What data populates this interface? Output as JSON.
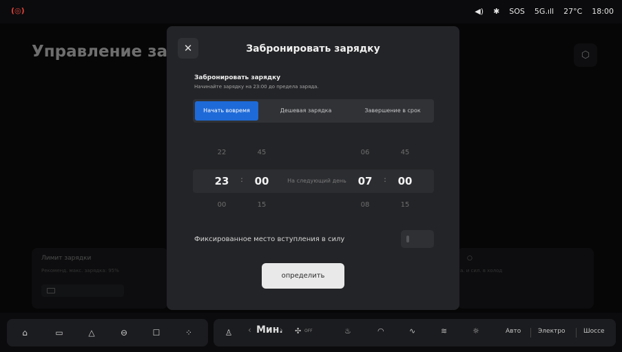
{
  "status_bar": {
    "alert_icon": "warning-icon",
    "volume_icon": "volume-icon",
    "bluetooth_icon": "bluetooth-icon",
    "sos": "SOS",
    "network": "5G",
    "signal_icon": "signal-icon",
    "temperature": "27°C",
    "time": "18:00"
  },
  "background": {
    "page_title": "Управление заря",
    "settings_icon": "settings-icon",
    "charge_limit_card": {
      "title": "Лимит зарядки",
      "subtitle": "Рекоменд. макс. зарядка: 95%"
    },
    "right_card": {
      "subtitle": "а. и сил. в холод"
    }
  },
  "modal": {
    "title": "Забронировать зарядку",
    "close_icon": "close-icon",
    "section_title": "Забронировать зарядку",
    "section_subtitle": "Начинайте зарядку на 23:00 до предела заряда.",
    "tabs": [
      {
        "label": "Начать вовремя",
        "active": true
      },
      {
        "label": "Дешевая зарядка",
        "active": false
      },
      {
        "label": "Завершение в срок",
        "active": false
      }
    ],
    "picker": {
      "start_hour": {
        "prev": "22",
        "current": "23",
        "next": "00"
      },
      "start_minute": {
        "prev": "45",
        "current": "00",
        "next": "15"
      },
      "separator": ":",
      "next_day_label": "На следующий день",
      "end_hour": {
        "prev": "06",
        "current": "07",
        "next": "08"
      },
      "end_minute": {
        "prev": "45",
        "current": "00",
        "next": "15"
      }
    },
    "fixed_location_label": "Фиксированное место вступления в силу",
    "fixed_location_enabled": false,
    "confirm_label": "определить"
  },
  "dock": {
    "left_icons": [
      "home-icon",
      "screen-icon",
      "navigation-icon",
      "car-icon",
      "seat-icon",
      "apps-icon"
    ],
    "climate": {
      "seat_icon": "seat-belt-icon",
      "fan_prev": "‹",
      "fan_value": "Мин.",
      "fan_next": "›",
      "fan_icon": "fan-icon",
      "fan_state": "OFF",
      "seat_heat_icon": "seat-heat-icon",
      "front_defrost_icon": "front-defrost-icon",
      "wiper_icon": "wiper-icon",
      "rear_defrost_icon": "rear-defrost-icon",
      "light_icon": "light-icon"
    },
    "modes": [
      "Авто",
      "Электро",
      "Шоссе"
    ]
  }
}
